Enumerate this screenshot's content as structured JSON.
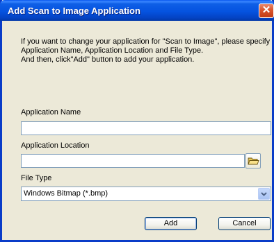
{
  "window": {
    "title": "Add Scan to Image Application",
    "close_glyph": "✕"
  },
  "instructions": [
    "If you want to change your application for \"Scan to Image\", please specify",
    "Application Name, Application Location and File Type.",
    "And then, click\"Add\" button to add your application."
  ],
  "form": {
    "app_name_label": "Application Name",
    "app_name_value": "",
    "app_location_label": "Application Location",
    "app_location_value": "",
    "file_type_label": "File Type",
    "file_type_value": "Windows Bitmap (*.bmp)",
    "browse_icon": "folder-icon",
    "dropdown_icon": "chevron-down-icon"
  },
  "buttons": {
    "add_label": "Add",
    "cancel_label": "Cancel"
  },
  "colors": {
    "titlebar": "#0553e0",
    "window_bg": "#ece9d8",
    "close": "#d9542c",
    "field_border": "#7f9db9"
  }
}
